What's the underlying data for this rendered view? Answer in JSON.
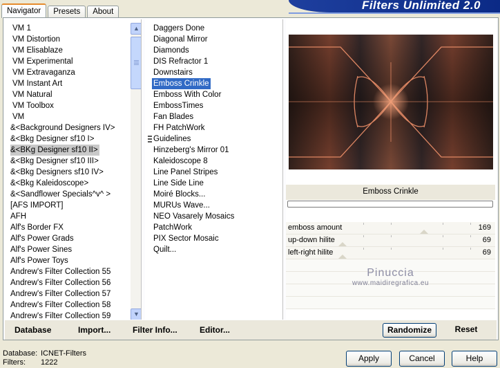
{
  "tabs": [
    "Navigator",
    "Presets",
    "About"
  ],
  "banner": "Filters Unlimited 2.0",
  "categories": [
    "VM 1",
    "VM Distortion",
    "VM Elisablaze",
    "VM Experimental",
    "VM Extravaganza",
    "VM Instant Art",
    "VM Natural",
    "VM Toolbox",
    "VM",
    "&<Background Designers IV>",
    "&<Bkg Designer sf10 I>",
    "&<BKg Designer sf10 II>",
    "&<Bkg Designer sf10 III>",
    "&<Bkg Designers sf10 IV>",
    "&<Bkg Kaleidoscope>",
    "&<Sandflower Specials^v^ >",
    "[AFS IMPORT]",
    "AFH",
    "Alf's Border FX",
    "Alf's Power Grads",
    "Alf's Power Sines",
    "Alf's Power Toys",
    "Andrew's Filter Collection 55",
    "Andrew's Filter Collection 56",
    "Andrew's Filter Collection 57",
    "Andrew's Filter Collection 58",
    "Andrew's Filter Collection 59"
  ],
  "selected_category": "&<BKg Designer sf10 II>",
  "filters": [
    "Daggers Done",
    "Diagonal Mirror",
    "Diamonds",
    "DIS Refractor 1",
    "Downstairs",
    "Emboss Crinkle",
    "Emboss With Color",
    "EmbossTimes",
    "Fan Blades",
    "FH PatchWork",
    "Guidelines",
    "Hinzeberg's Mirror 01",
    "Kaleidoscope 8",
    "Line Panel Stripes",
    "Line Side Line",
    "Moiré Blocks...",
    "MURUs Wave...",
    "NEO Vasarely Mosaics",
    "PatchWork",
    "PIX Sector Mosaic",
    "Quilt..."
  ],
  "selected_filter": "Emboss Crinkle",
  "filter_title": "Emboss Crinkle",
  "params": [
    {
      "label": "emboss amount",
      "value": "169",
      "level": 0.66
    },
    {
      "label": "up-down hilite",
      "value": "69",
      "level": 0.27
    },
    {
      "label": "left-right hilite",
      "value": "69",
      "level": 0.27
    }
  ],
  "watermark": {
    "line1": "Pinuccia",
    "line2": "www.maidiregrafica.eu"
  },
  "toolbar": {
    "database": "Database",
    "import": "Import...",
    "filter_info": "Filter Info...",
    "editor": "Editor...",
    "randomize": "Randomize",
    "reset": "Reset"
  },
  "status": {
    "db_label": "Database:",
    "db_value": "ICNET-Filters",
    "filters_label": "Filters:",
    "filters_value": "1222"
  },
  "buttons": {
    "apply": "Apply",
    "cancel": "Cancel",
    "help": "Help"
  },
  "colors": {
    "accent": "#316ac5",
    "banner": "#0b2a86",
    "preview_bg": "#2a1f1b",
    "preview_glow": "#e07a4f"
  }
}
